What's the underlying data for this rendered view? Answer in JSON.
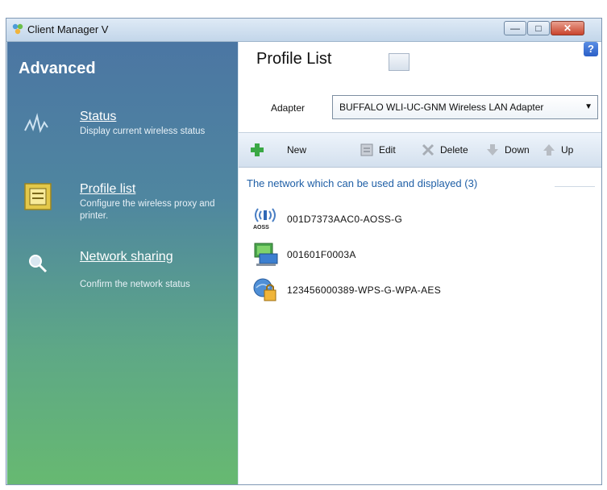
{
  "window": {
    "title": "Client Manager V",
    "controls": {
      "minimize": "—",
      "maximize": "□",
      "close": "✕"
    }
  },
  "sidebar": {
    "title": "Advanced",
    "items": [
      {
        "label": "Status",
        "description": "Display current wireless status",
        "icon": "wave-icon"
      },
      {
        "label": "Profile list",
        "description": "Configure the wireless proxy and printer.",
        "icon": "profile-list-icon"
      },
      {
        "label": "Network sharing",
        "description": "Confirm the network status",
        "icon": "magnifier-icon"
      }
    ]
  },
  "main": {
    "title": "Profile List",
    "help": "?",
    "adapter": {
      "label": "Adapter",
      "value": "BUFFALO WLI-UC-GNM Wireless LAN Adapter"
    },
    "toolbar": {
      "new": "New",
      "edit": "Edit",
      "delete": "Delete",
      "down": "Down",
      "up": "Up"
    },
    "group_header": "The network which can be used and displayed  (3)",
    "networks": [
      {
        "ssid": "001D7373AAC0-AOSS-G",
        "badge": "AOSS",
        "icon": "aoss-signal-icon"
      },
      {
        "ssid": "001601F0003A",
        "icon": "computer-network-icon"
      },
      {
        "ssid": "123456000389-WPS-G-WPA-AES",
        "icon": "secure-network-icon"
      }
    ]
  }
}
